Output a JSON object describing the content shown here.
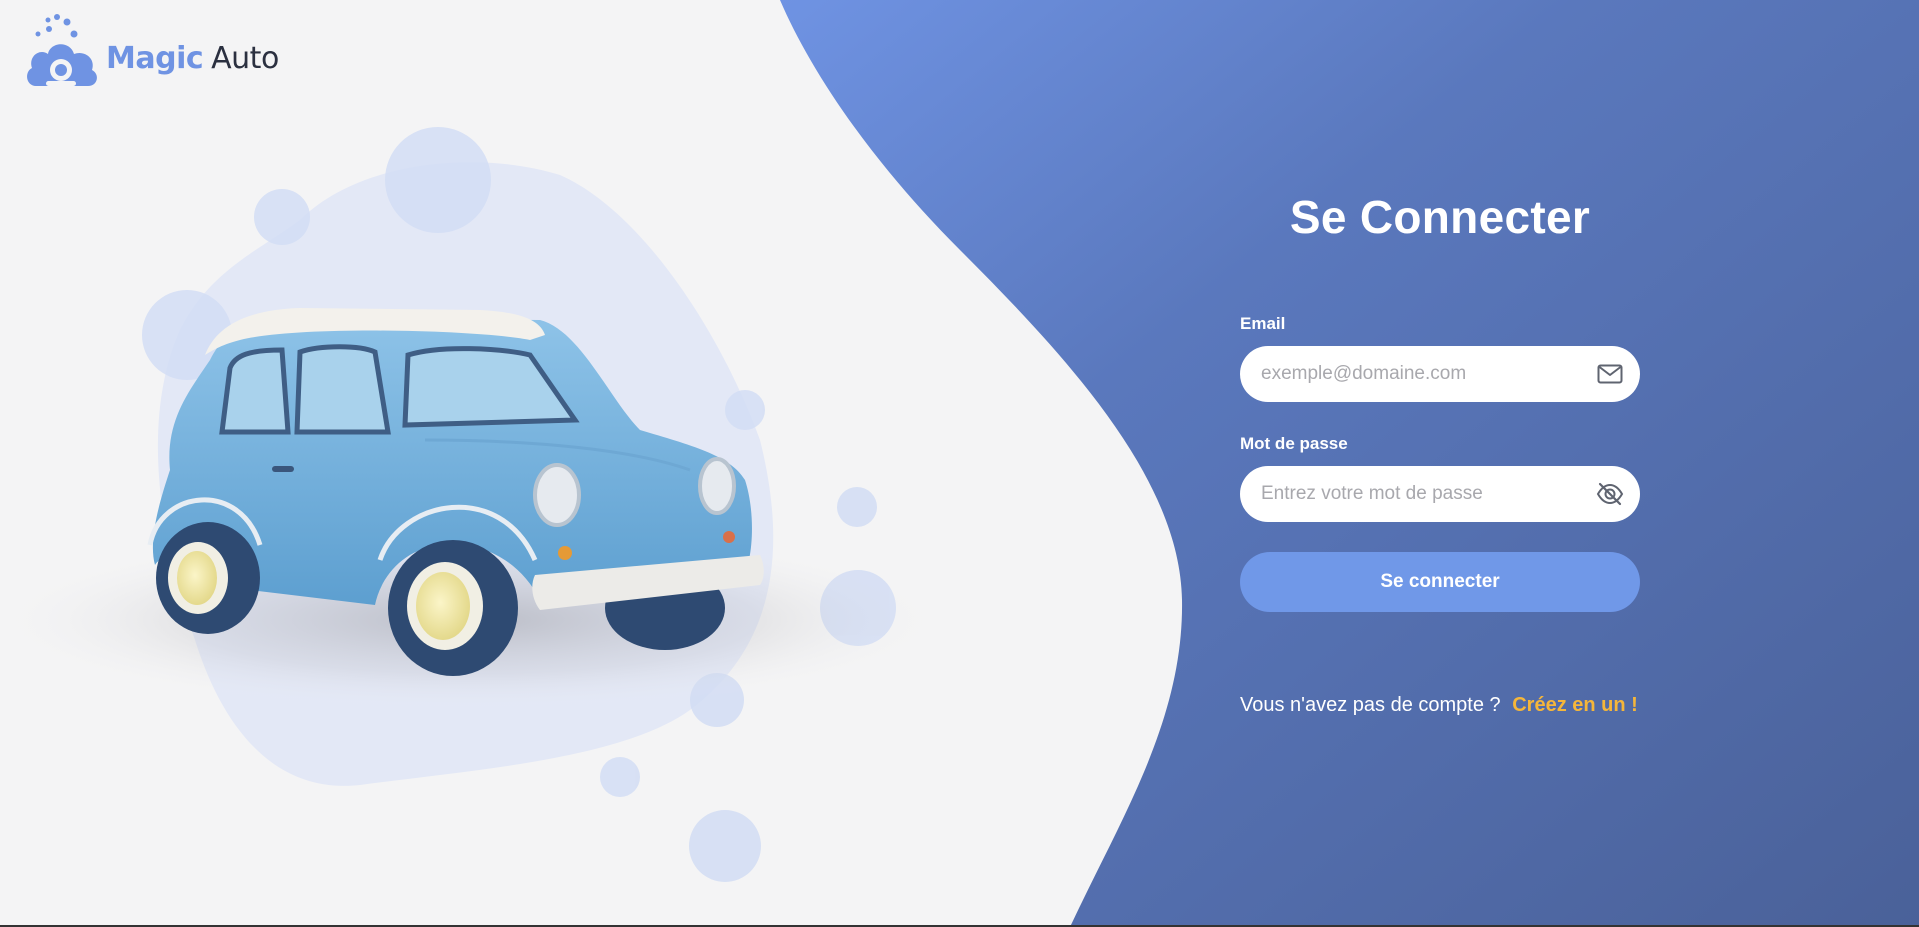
{
  "brand": {
    "name_bold": "Magic",
    "name_light": "Auto"
  },
  "login": {
    "title": "Se Connecter",
    "email_label": "Email",
    "email_placeholder": "exemple@domaine.com",
    "password_label": "Mot de passe",
    "password_placeholder": "Entrez votre mot de passe",
    "submit_label": "Se connecter",
    "no_account_text": "Vous n'avez pas de compte ?",
    "signup_link": "Créez en un !"
  },
  "icons": {
    "email": "envelope-icon",
    "password": "eye-slash-icon",
    "logo": "car-cloud-logo-icon"
  },
  "colors": {
    "panel_blue": "#4f6aa6",
    "panel_blue_light": "#6f93e3",
    "button": "#7098e8",
    "link": "#f5b63a",
    "page_bg": "#f4f4f5"
  }
}
